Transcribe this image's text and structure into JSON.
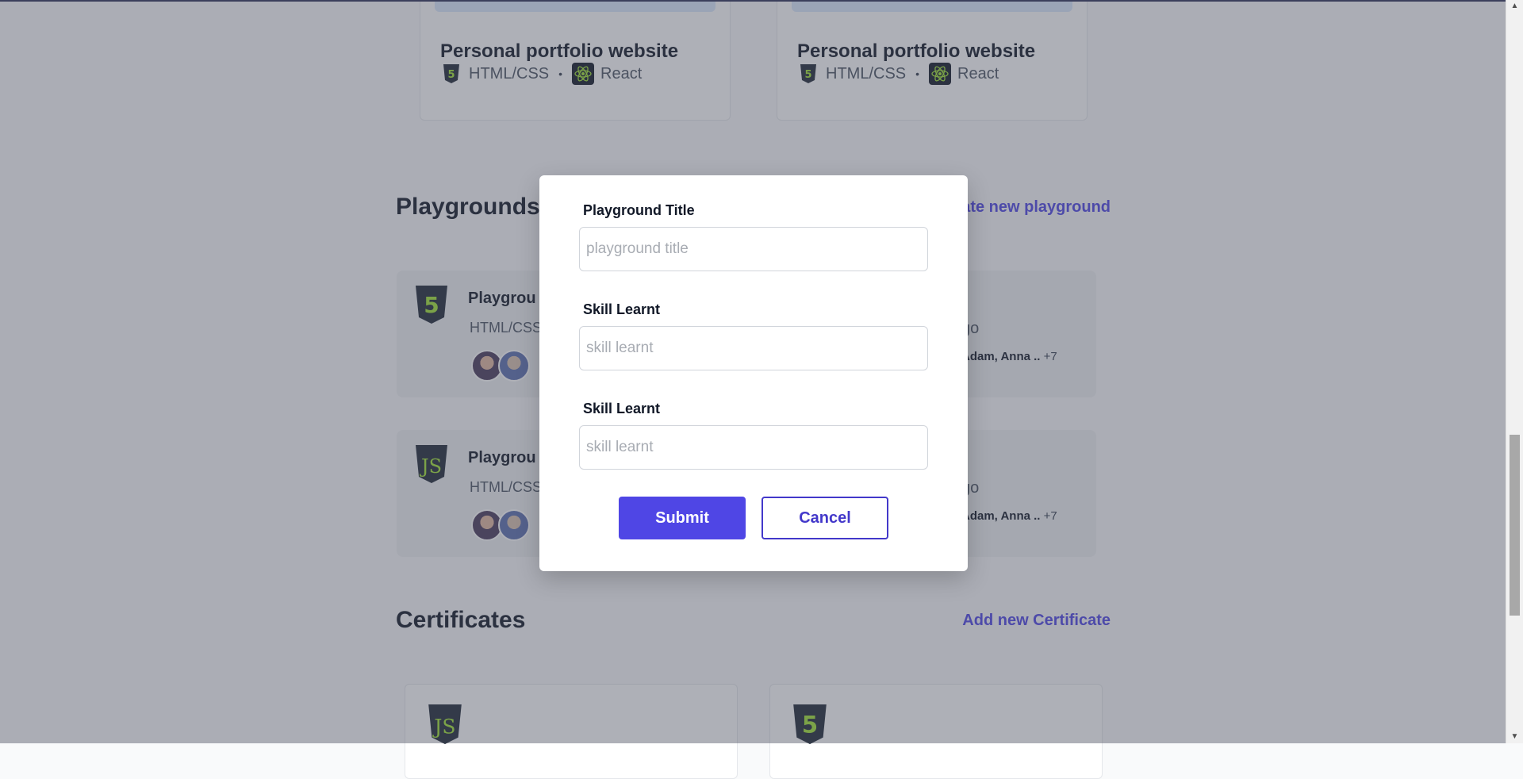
{
  "projects": [
    {
      "title": "Personal portfolio website",
      "tags": [
        "HTML/CSS",
        "React"
      ],
      "separator": "•"
    },
    {
      "title": "Personal portfolio website",
      "tags": [
        "HTML/CSS",
        "React"
      ],
      "separator": "•"
    }
  ],
  "playgrounds_section": {
    "title": "Playgrounds",
    "link": "Create new playground",
    "cards": [
      {
        "title_visible": "Playgrou",
        "subtitle_visible": "HTML/CSS",
        "ago_visible": "go",
        "people": "Adam, Anna ..",
        "more": "+7",
        "logo": "html5-icon"
      },
      {
        "title_visible": "Playgrou",
        "subtitle_visible": "HTML/CSS",
        "ago_visible": "go",
        "people": "Adam, Anna ..",
        "more": "+7",
        "logo": "javascript-icon"
      }
    ]
  },
  "certificates_section": {
    "title": "Certificates",
    "link": "Add new Certificate"
  },
  "modal": {
    "fields": [
      {
        "label": "Playground Title",
        "placeholder": "playground title",
        "value": ""
      },
      {
        "label": "Skill Learnt",
        "placeholder": "skill learnt",
        "value": ""
      },
      {
        "label": "Skill Learnt",
        "placeholder": "skill learnt",
        "value": ""
      }
    ],
    "submit_label": "Submit",
    "cancel_label": "Cancel"
  },
  "colors": {
    "accent": "#4f46e5",
    "overlay": "rgba(75,80,96,0.45)",
    "js_green": "#a3e635",
    "logo_dark": "#1f2937"
  }
}
